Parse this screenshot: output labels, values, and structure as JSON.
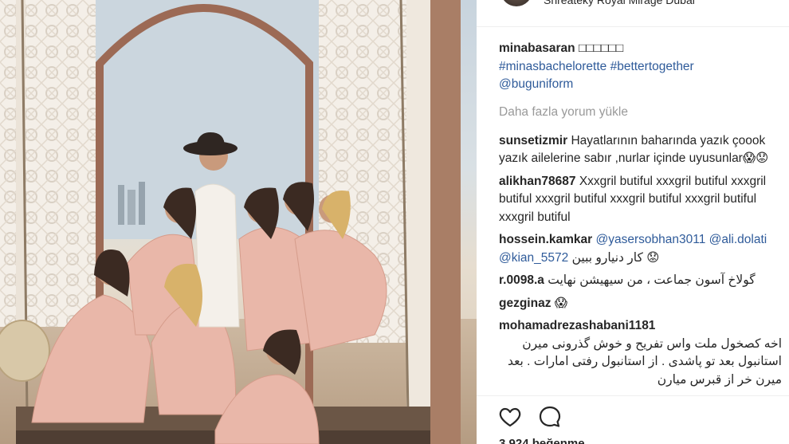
{
  "post": {
    "location": "Shreateky Royal Mirage Dubai",
    "likes": "3.924 beğenme",
    "load_more": "Daha fazla yorum yükle"
  },
  "caption": {
    "user": "minabasaran",
    "emoji": "□□□□□□",
    "hashtags": "#minasbachelorette #bettertogether",
    "mention": "@buguniform"
  },
  "comments": [
    {
      "user": "sunsetizmir",
      "text": "Hayatlarının baharında yazık çoook yazık ailelerine sabır ,nurlar içinde uyusunlar😱😟"
    },
    {
      "user": "alikhan78687",
      "text": "Xxxgril butiful xxxgril butiful xxxgril butiful xxxgril butiful xxxgril butiful xxxgril butiful xxxgril butiful"
    },
    {
      "user": "hossein.kamkar",
      "mentions": "@yasersobhan3011 @ali.dolati @kian_5572",
      "text": "کار دنیارو ببین 😟"
    },
    {
      "user": "r.0098.a",
      "text": "گولاخ آسون جماعت ، من سیهیشن نهایت"
    },
    {
      "user": "gezginaz",
      "text": "😱"
    },
    {
      "user": "mohamadrezashabani1181",
      "text": "اخه کصخول ملت واس تفریح و خوش گذرونی میرن استانبول بعد تو پاشدی . از استانبول رفتی امارات . بعد میرن خر از قبرس میارن"
    }
  ],
  "icons": {
    "like": "heart-icon",
    "comment": "comment-icon"
  }
}
